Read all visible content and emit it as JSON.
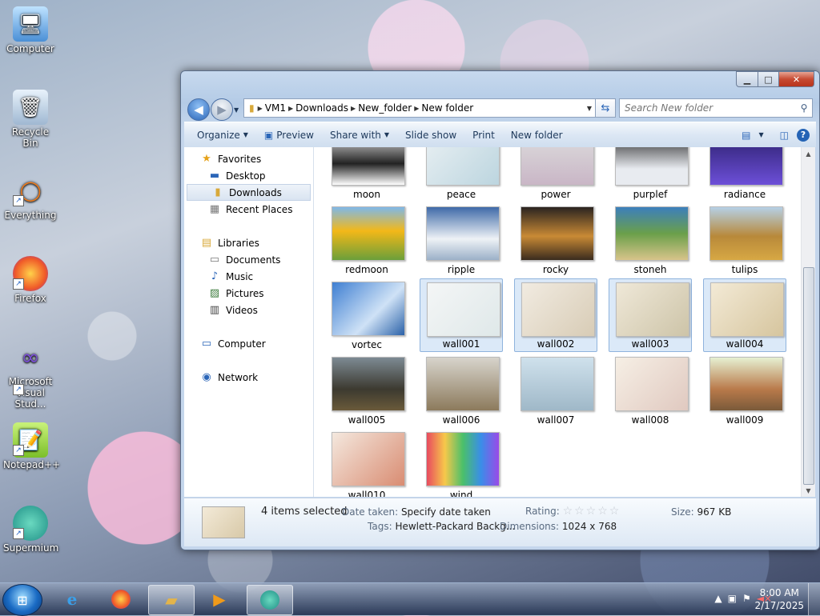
{
  "desktop": {
    "icons": [
      {
        "label": "Computer",
        "icon": "computer-icon"
      },
      {
        "label": "Recycle Bin",
        "icon": "recycle-bin-icon"
      },
      {
        "label": "Everything",
        "icon": "everything-icon"
      },
      {
        "label": "Firefox",
        "icon": "firefox-icon"
      },
      {
        "label": "Microsoft Visual Stud...",
        "icon": "visual-studio-icon"
      },
      {
        "label": "Notepad++",
        "icon": "notepadpp-icon"
      },
      {
        "label": "Supermium",
        "icon": "supermium-icon"
      }
    ]
  },
  "window": {
    "controls": {
      "minimize": "▁",
      "maximize": "□",
      "close": "✕"
    },
    "address": {
      "segments": [
        "VM1",
        "Downloads",
        "New_folder",
        "New folder"
      ]
    },
    "search": {
      "placeholder": "Search New folder"
    },
    "toolbar": {
      "organize": "Organize",
      "preview": "Preview",
      "share_with": "Share with",
      "slide_show": "Slide show",
      "print": "Print",
      "new_folder": "New folder",
      "help": "?"
    },
    "nav": {
      "favorites": "Favorites",
      "desktop": "Desktop",
      "downloads": "Downloads",
      "recent_places": "Recent Places",
      "libraries": "Libraries",
      "documents": "Documents",
      "music": "Music",
      "pictures": "Pictures",
      "videos": "Videos",
      "computer": "Computer",
      "network": "Network"
    },
    "files": [
      {
        "name": "moon",
        "selected": false
      },
      {
        "name": "peace",
        "selected": false
      },
      {
        "name": "power",
        "selected": false
      },
      {
        "name": "purplef",
        "selected": false
      },
      {
        "name": "radiance",
        "selected": false
      },
      {
        "name": "redmoon",
        "selected": false
      },
      {
        "name": "ripple",
        "selected": false
      },
      {
        "name": "rocky",
        "selected": false
      },
      {
        "name": "stoneh",
        "selected": false
      },
      {
        "name": "tulips",
        "selected": false
      },
      {
        "name": "vortec",
        "selected": false
      },
      {
        "name": "wall001",
        "selected": true
      },
      {
        "name": "wall002",
        "selected": true
      },
      {
        "name": "wall003",
        "selected": true
      },
      {
        "name": "wall004",
        "selected": true
      },
      {
        "name": "wall005",
        "selected": false
      },
      {
        "name": "wall006",
        "selected": false
      },
      {
        "name": "wall007",
        "selected": false
      },
      {
        "name": "wall008",
        "selected": false
      },
      {
        "name": "wall009",
        "selected": false
      },
      {
        "name": "wall010",
        "selected": false
      },
      {
        "name": "wind",
        "selected": false
      }
    ],
    "details": {
      "count": "4 items selected",
      "date_taken_label": "Date taken:",
      "date_taken_value": "Specify date taken",
      "tags_label": "Tags:",
      "tags_value": "Hewlett-Packard Backg...",
      "rating_label": "Rating:",
      "rating_stars": "☆☆☆☆☆",
      "dimensions_label": "Dimensions:",
      "dimensions_value": "1024 x 768",
      "size_label": "Size:",
      "size_value": "967 KB"
    }
  },
  "taskbar": {
    "time": "8:00 AM",
    "date": "2/17/2025"
  }
}
